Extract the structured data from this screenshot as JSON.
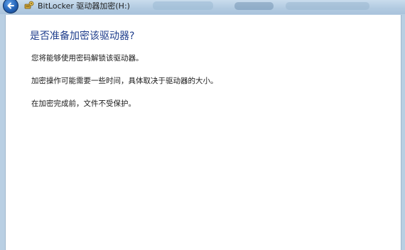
{
  "window": {
    "title": "BitLocker 驱动器加密(H:)",
    "back_icon": "back-arrow-icon",
    "app_icon": "bitlocker-key-icon"
  },
  "main": {
    "heading": "是否准备加密该驱动器?",
    "paragraphs": [
      "您将能够使用密码解锁该驱动器。",
      "加密操作可能需要一些时间，具体取决于驱动器的大小。",
      "在加密完成前，文件不受保护。"
    ]
  },
  "colors": {
    "heading": "#1e3d8c",
    "titlebar": "#b3cbe1",
    "back_button": "#2463b7"
  }
}
